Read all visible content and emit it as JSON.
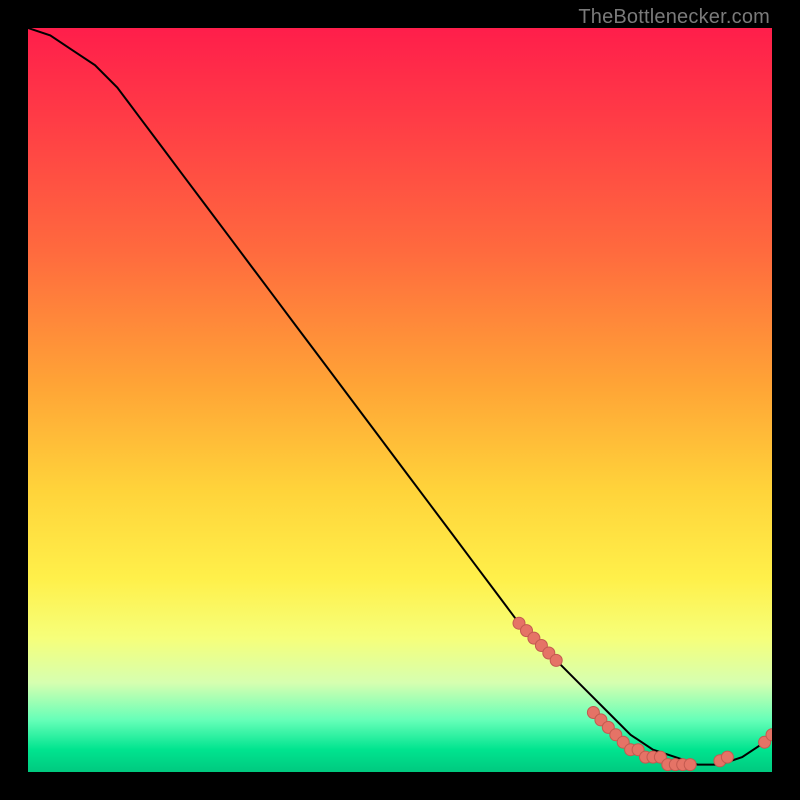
{
  "attribution": "TheBottlenecker.com",
  "colors": {
    "curve": "#000000",
    "marker_fill": "#e57366",
    "marker_stroke": "#c35a50",
    "frame": "#000000"
  },
  "chart_data": {
    "type": "line",
    "title": "",
    "xlabel": "",
    "ylabel": "",
    "xlim": [
      0,
      100
    ],
    "ylim": [
      0,
      100
    ],
    "grid": false,
    "series": [
      {
        "name": "bottleneck-curve",
        "x": [
          0,
          3,
          6,
          9,
          12,
          15,
          18,
          21,
          24,
          27,
          30,
          33,
          36,
          39,
          42,
          45,
          48,
          51,
          54,
          57,
          60,
          63,
          66,
          69,
          72,
          75,
          78,
          81,
          84,
          87,
          90,
          93,
          96,
          99,
          100
        ],
        "y": [
          100,
          99,
          97,
          95,
          92,
          88,
          84,
          80,
          76,
          72,
          68,
          64,
          60,
          56,
          52,
          48,
          44,
          40,
          36,
          32,
          28,
          24,
          20,
          17,
          14,
          11,
          8,
          5,
          3,
          2,
          1,
          1,
          2,
          4,
          5
        ]
      }
    ],
    "markers": {
      "name": "highlighted-points",
      "x": [
        66,
        67,
        68,
        69,
        70,
        71,
        76,
        77,
        78,
        79,
        80,
        81,
        82,
        83,
        84,
        85,
        86,
        87,
        88,
        89,
        93,
        94,
        99,
        100
      ],
      "y": [
        20,
        19,
        18,
        17,
        16,
        15,
        8,
        7,
        6,
        5,
        4,
        3,
        3,
        2,
        2,
        2,
        1,
        1,
        1,
        1,
        1.5,
        2,
        4,
        5
      ]
    }
  }
}
